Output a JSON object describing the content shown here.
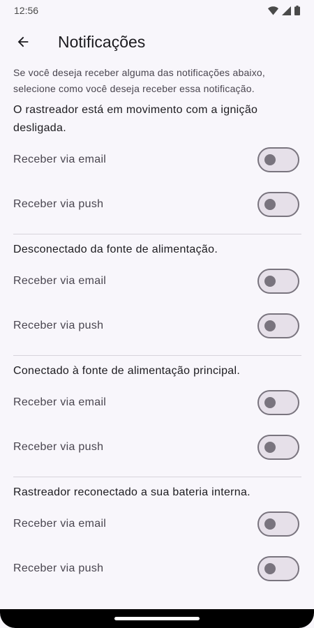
{
  "status_bar": {
    "time": "12:56"
  },
  "app_bar": {
    "title": "Notificações"
  },
  "intro": "Se você deseja receber alguma das notificações abaixo, selecione como você deseja receber essa notificação.",
  "sections": [
    {
      "title": "O rastreador está em movimento com a ignição desligada.",
      "email_label": "Receber via email",
      "push_label": "Receber via push",
      "email_enabled": false,
      "push_enabled": false
    },
    {
      "title": "Desconectado da fonte de alimentação.",
      "email_label": "Receber via email",
      "push_label": "Receber via push",
      "email_enabled": false,
      "push_enabled": false
    },
    {
      "title": "Conectado à fonte de alimentação principal.",
      "email_label": "Receber via email",
      "push_label": "Receber via push",
      "email_enabled": false,
      "push_enabled": false
    },
    {
      "title": "Rastreador reconectado a sua bateria interna.",
      "email_label": "Receber via email",
      "push_label": "Receber via push",
      "email_enabled": false,
      "push_enabled": false
    }
  ]
}
